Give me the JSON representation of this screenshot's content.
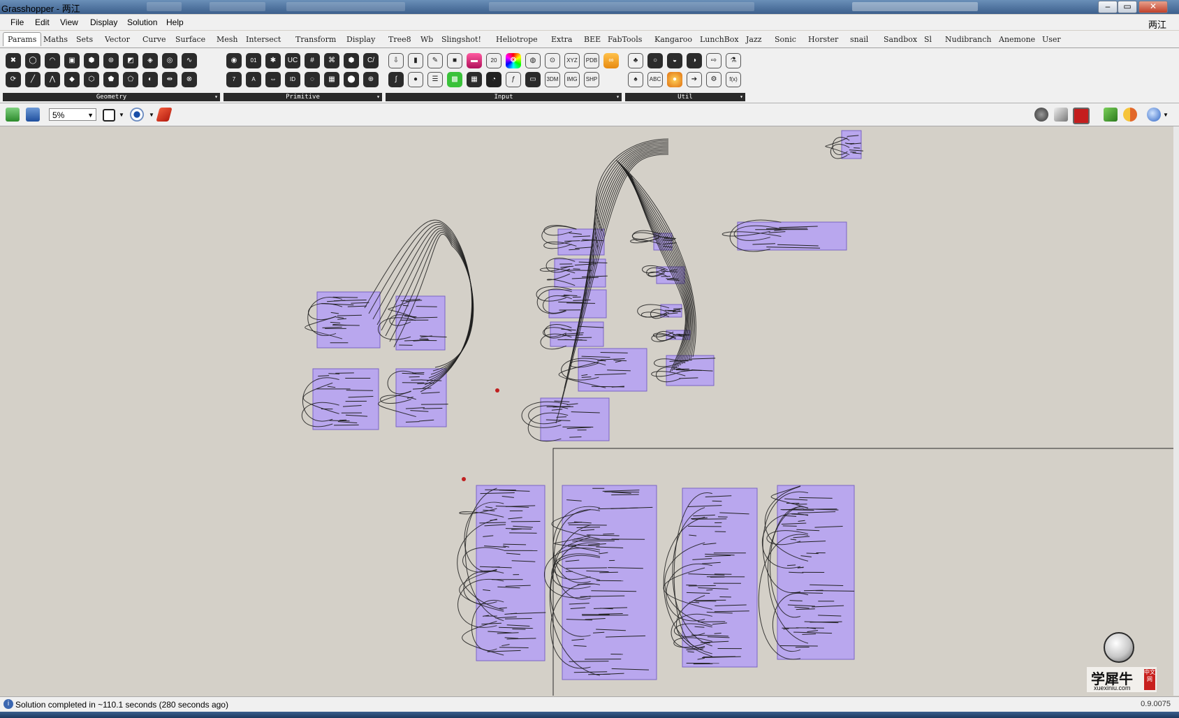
{
  "window": {
    "title": "Grasshopper - 两江",
    "minimize": "‒",
    "maximize": "▭",
    "close": "✕"
  },
  "menu": {
    "items": [
      "File",
      "Edit",
      "View",
      "Display",
      "Solution",
      "Help"
    ],
    "right_label": "两江"
  },
  "tabs": [
    "Params",
    "Maths",
    "Sets",
    "Vector",
    "Curve",
    "Surface",
    "Mesh",
    "Intersect",
    "Transform",
    "Display",
    "Tree8",
    "Wb",
    "Slingshot!",
    "Heliotrope",
    "Extra",
    "BEE",
    "FabTools",
    "Kangaroo",
    "LunchBox",
    "Jazz",
    "Sonic",
    "Horster",
    "snail",
    "Sandbox",
    "Sl",
    "Nudibranch",
    "Anemone",
    "User"
  ],
  "active_tab": "Params",
  "ribbon": {
    "panels": [
      {
        "label": "Geometry",
        "icons": [
          "point-icon",
          "circle-icon",
          "arc-icon",
          "box-icon",
          "brep-icon",
          "circle-param-icon",
          "surface-icon",
          "field-icon",
          "curve-icon",
          "geometry-icon",
          "group-icon",
          "line-icon",
          "mesh-icon",
          "mesh-face-icon",
          "plane-icon",
          "box-shape-icon",
          "surface-param-icon",
          "twisted-box-icon",
          "transform-icon",
          "vector-icon"
        ]
      },
      {
        "label": "Primitive",
        "icons": [
          "boolean-icon",
          "integer-icon",
          "colour-icon",
          "culture-icon",
          "domain-icon",
          "domain2-icon",
          "complex-icon",
          "file-path-icon",
          "number-icon",
          "text-icon",
          "interval-icon",
          "shape-icon",
          "guid-icon",
          "matrix-icon",
          "time-icon",
          "path-icon"
        ]
      },
      {
        "label": "Input",
        "icons": [
          "import-icon",
          "toggle-icon",
          "panel-icon",
          "button-icon",
          "gradient-icon",
          "calendar-icon",
          "colour-wheel-icon",
          "swatch-icon",
          "control-icon",
          "xyz-icon",
          "pdb-icon",
          "graph-icon",
          "bezier-icon",
          "knob-icon",
          "list-icon",
          "image-sampler-icon",
          "matrix-icon",
          "clock-icon",
          "function-icon",
          "slider-icon",
          "model-3dm-icon",
          "image-icon",
          "shp-icon"
        ]
      },
      {
        "label": "Util",
        "icons": [
          "cherry-icon",
          "ring-icon",
          "cup-icon",
          "disc-icon",
          "arrow-icon",
          "flask-icon",
          "tree-icon",
          "abc-icon",
          "bulb-icon",
          "right-arrow-icon",
          "gear-icon",
          "fx-icon"
        ]
      }
    ],
    "calendar_text": "20",
    "xyz_text": "XYZ",
    "pdb_text": "PDB",
    "model_text": "3DM",
    "img_text": "IMG",
    "shp_text": "SHP",
    "abc_text": "ABC",
    "fx_text": "f(x)",
    "number_7": "7",
    "text_A": "A",
    "id_text": "ID",
    "int_text": "01"
  },
  "canvas_toolbar": {
    "zoom": "5%"
  },
  "status": {
    "message": "Solution completed in ~110.1 seconds (280 seconds ago)",
    "version": "0.9.0075"
  },
  "watermark": {
    "chinese": "学犀牛",
    "domain": "xuexiniu.com",
    "seal": "中文网"
  },
  "colors": {
    "group_fill": "#b9a7ee",
    "canvas": "#d4d0c8",
    "titlebar": "#3c5f8c"
  }
}
